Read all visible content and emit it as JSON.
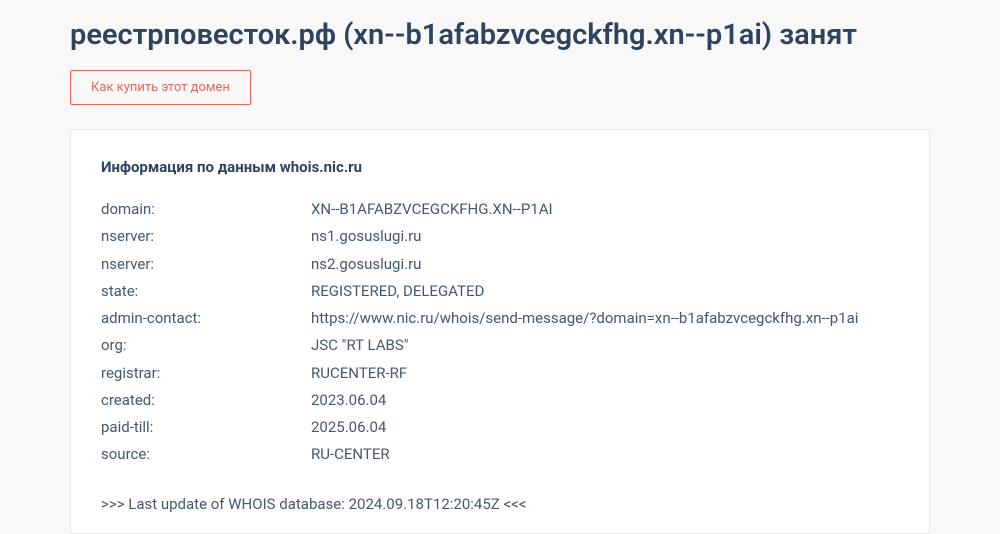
{
  "page_title": "реестрповесток.рф (xn--b1afabzvcegckfhg.xn--p1ai) занят",
  "buy_button_label": "Как купить этот домен",
  "whois": {
    "heading": "Информация по данным whois.nic.ru",
    "rows": [
      {
        "key": "domain:",
        "value": "XN--B1AFABZVCEGCKFHG.XN--P1AI"
      },
      {
        "key": "nserver:",
        "value": "ns1.gosuslugi.ru"
      },
      {
        "key": "nserver:",
        "value": "ns2.gosuslugi.ru"
      },
      {
        "key": "state:",
        "value": "REGISTERED, DELEGATED"
      },
      {
        "key": "admin-contact:",
        "value": "https://www.nic.ru/whois/send-message/?domain=xn--b1afabzvcegckfhg.xn--p1ai"
      },
      {
        "key": "org:",
        "value": "JSC \"RT LABS\""
      },
      {
        "key": "registrar:",
        "value": "RUCENTER-RF"
      },
      {
        "key": "created:",
        "value": "2023.06.04"
      },
      {
        "key": "paid-till:",
        "value": "2025.06.04"
      },
      {
        "key": "source:",
        "value": "RU-CENTER"
      }
    ],
    "last_update": ">>> Last update of WHOIS database: 2024.09.18T12:20:45Z <<<"
  }
}
